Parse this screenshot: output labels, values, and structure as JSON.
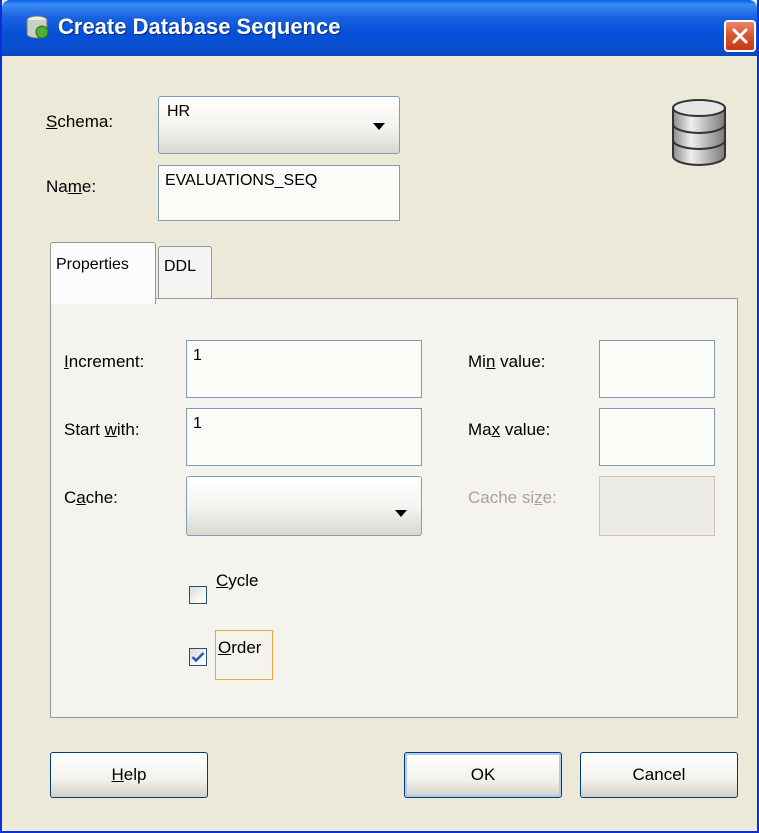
{
  "window": {
    "title": "Create Database Sequence"
  },
  "schema": {
    "label": "Schema:",
    "value": "HR"
  },
  "name": {
    "label": "Name:",
    "value": "EVALUATIONS_SEQ"
  },
  "tabs": [
    {
      "label": "Properties",
      "active": true
    },
    {
      "label": "DDL",
      "active": false
    }
  ],
  "properties": {
    "increment": {
      "label": "Increment:",
      "value": "1"
    },
    "start_with": {
      "label": "Start with:",
      "value": "1"
    },
    "cache": {
      "label": "Cache:",
      "value": ""
    },
    "min_value": {
      "label": "Min value:",
      "value": ""
    },
    "max_value": {
      "label": "Max value:",
      "value": ""
    },
    "cache_size": {
      "label": "Cache size:",
      "value": "",
      "enabled": false
    },
    "cycle": {
      "label": "Cycle",
      "checked": false
    },
    "order": {
      "label": "Order",
      "checked": true
    }
  },
  "buttons": {
    "help": "Help",
    "ok": "OK",
    "cancel": "Cancel"
  },
  "colors": {
    "title_bar": "#0a5fe8",
    "dialog_bg": "#ece9d8",
    "focus": "#e8a53a",
    "check": "#2f55b8"
  }
}
